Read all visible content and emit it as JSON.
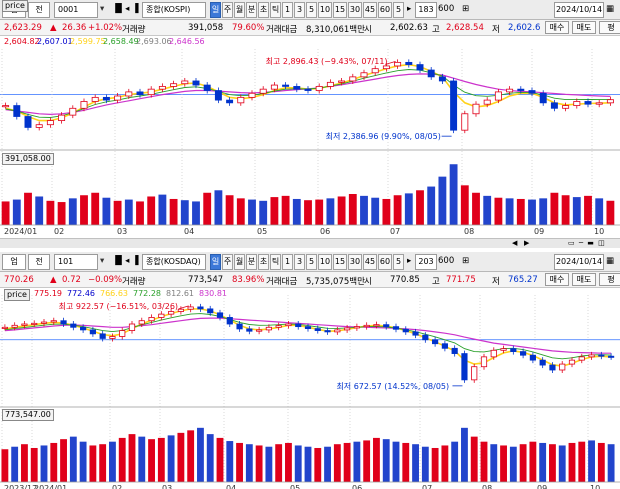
{
  "panels": [
    {
      "toolbar": {
        "type": "업",
        "mode": "전",
        "code": "0001",
        "index_name": "종합(KOSPI)",
        "period_buttons": [
          "일",
          "주",
          "월",
          "분",
          "초",
          "틱",
          "1",
          "3",
          "5",
          "10",
          "15",
          "30",
          "45",
          "60",
          "5"
        ],
        "selected_period": "일",
        "count": "183",
        "total": "600",
        "date": "2024/10/14",
        "volume_label": "거래량",
        "amount_label": "거래대금",
        "low_label": "저",
        "sell_button": "매수",
        "buy_button": "매도",
        "extra_button": "평"
      },
      "status": {
        "price": "2,623.29",
        "change": "26.36",
        "pct": "+1.02%",
        "volume": "391,058",
        "vol_pct": "79.60%",
        "amount": "8,310,061백만",
        "amount_unit": "시",
        "open": "2,602.63",
        "high_label": "고",
        "high": "2,628.54",
        "low": "2,602.6"
      },
      "legend": {
        "prefix": "",
        "values": [
          "2,604.82",
          "2,607.01",
          "2,599.75",
          "2,658.49",
          "2,693.06",
          "2,646.56"
        ],
        "colors": [
          "#e0001a",
          "#0000cc",
          "#ffd21a",
          "#2aa02a",
          "#808080",
          "#cc33cc"
        ],
        "price_tag": "price",
        "volume_tag": "391,058.00"
      },
      "annotations": {
        "high": "최고 2,896.43 (−9.43%, 07/11)",
        "low": "최저 2,386.96 (9.90%, 08/05)"
      },
      "chart_data": {
        "type": "line",
        "title": "종합(KOSPI)",
        "x_ticks": [
          "2024/01",
          "02",
          "03",
          "04",
          "05",
          "06",
          "07",
          "08",
          "09",
          "10"
        ],
        "price_series": [
          2580,
          2500,
          2420,
          2440,
          2470,
          2510,
          2560,
          2610,
          2640,
          2620,
          2650,
          2680,
          2660,
          2700,
          2720,
          2740,
          2760,
          2730,
          2690,
          2620,
          2600,
          2640,
          2670,
          2700,
          2730,
          2720,
          2700,
          2690,
          2720,
          2750,
          2760,
          2790,
          2820,
          2850,
          2870,
          2896,
          2880,
          2840,
          2790,
          2760,
          2400,
          2520,
          2590,
          2620,
          2680,
          2700,
          2690,
          2670,
          2600,
          2560,
          2580,
          2610,
          2590,
          2600,
          2623
        ],
        "ma_slow": [
          2550,
          2540,
          2530,
          2520,
          2515,
          2520,
          2530,
          2545,
          2565,
          2585,
          2600,
          2615,
          2630,
          2645,
          2660,
          2672,
          2684,
          2690,
          2690,
          2686,
          2680,
          2675,
          2672,
          2676,
          2682,
          2690,
          2696,
          2702,
          2710,
          2720,
          2732,
          2746,
          2760,
          2774,
          2788,
          2800,
          2808,
          2812,
          2810,
          2804,
          2780,
          2756,
          2734,
          2716,
          2700,
          2690,
          2684,
          2680,
          2674,
          2668,
          2662,
          2658,
          2654,
          2650,
          2647
        ],
        "ma_fast": [
          2560,
          2540,
          2500,
          2470,
          2470,
          2490,
          2525,
          2570,
          2610,
          2630,
          2640,
          2660,
          2670,
          2680,
          2700,
          2720,
          2740,
          2745,
          2720,
          2680,
          2640,
          2630,
          2640,
          2660,
          2690,
          2710,
          2710,
          2700,
          2705,
          2725,
          2745,
          2770,
          2800,
          2825,
          2850,
          2870,
          2880,
          2865,
          2830,
          2790,
          2680,
          2600,
          2570,
          2580,
          2610,
          2650,
          2670,
          2670,
          2640,
          2600,
          2585,
          2590,
          2595,
          2597,
          2600
        ],
        "volume": [
          380,
          410,
          520,
          460,
          390,
          370,
          430,
          480,
          520,
          440,
          390,
          410,
          380,
          460,
          490,
          420,
          400,
          380,
          520,
          560,
          480,
          430,
          410,
          390,
          450,
          470,
          420,
          400,
          410,
          430,
          460,
          500,
          470,
          440,
          420,
          480,
          510,
          560,
          620,
          780,
          980,
          640,
          520,
          470,
          440,
          430,
          420,
          410,
          430,
          520,
          480,
          450,
          470,
          430,
          391
        ],
        "volume_colors": [
          "r",
          "b",
          "r",
          "b",
          "r",
          "r",
          "b",
          "r",
          "r",
          "b",
          "r",
          "b",
          "r",
          "r",
          "b",
          "r",
          "b",
          "b",
          "r",
          "b",
          "r",
          "r",
          "b",
          "b",
          "r",
          "r",
          "b",
          "r",
          "r",
          "b",
          "r",
          "r",
          "b",
          "b",
          "r",
          "r",
          "b",
          "r",
          "b",
          "b",
          "b",
          "r",
          "r",
          "b",
          "r",
          "b",
          "r",
          "b",
          "b",
          "r",
          "r",
          "b",
          "r",
          "b",
          "r"
        ],
        "ylim": [
          2350,
          2950
        ],
        "vol_max": 1000
      }
    },
    {
      "toolbar": {
        "type": "업",
        "mode": "전",
        "code": "101",
        "index_name": "종합(KOSDAQ)",
        "period_buttons": [
          "일",
          "주",
          "월",
          "분",
          "초",
          "틱",
          "1",
          "3",
          "5",
          "10",
          "15",
          "30",
          "45",
          "60",
          "5"
        ],
        "selected_period": "일",
        "count": "203",
        "total": "600",
        "date": "2024/10/14",
        "volume_label": "거래량",
        "amount_label": "거래대금",
        "low_label": "저",
        "sell_button": "매수",
        "buy_button": "매도",
        "extra_button": "평"
      },
      "status": {
        "price": "770.26",
        "change": "0.72",
        "pct": "−0.09%",
        "volume": "773,547",
        "vol_pct": "83.96%",
        "amount": "5,735,075백만",
        "amount_unit": "시",
        "open": "770.85",
        "high_label": "고",
        "high": "771.75",
        "low": "765.27"
      },
      "legend": {
        "prefix": "price",
        "values": [
          "775.19",
          "772.46",
          "766.63",
          "772.28",
          "812.61",
          "830.81"
        ],
        "colors": [
          "#e0001a",
          "#0000cc",
          "#ffd21a",
          "#2aa02a",
          "#808080",
          "#cc33cc"
        ],
        "price_tag": "price",
        "volume_tag": "773,547.00"
      },
      "annotations": {
        "high": "최고 922.57 (−16.51%, 03/26)",
        "low": "최저 672.57 (14.52%, 08/05)"
      },
      "chart_data": {
        "type": "line",
        "title": "종합(KOSDAQ)",
        "x_ticks": [
          "2023/12",
          "2024/01",
          "02",
          "03",
          "04",
          "05",
          "06",
          "07",
          "08",
          "09",
          "10"
        ],
        "price_series": [
          860,
          866,
          870,
          872,
          876,
          880,
          870,
          860,
          852,
          840,
          826,
          832,
          850,
          870,
          880,
          890,
          900,
          908,
          915,
          922,
          916,
          904,
          890,
          870,
          855,
          848,
          852,
          860,
          865,
          870,
          862,
          856,
          850,
          846,
          852,
          858,
          862,
          866,
          868,
          862,
          854,
          846,
          836,
          822,
          810,
          796,
          780,
          700,
          740,
          770,
          790,
          795,
          786,
          775,
          760,
          745,
          730,
          748,
          760,
          770,
          776,
          772,
          770
        ],
        "ma_slow": [
          850,
          852,
          855,
          858,
          861,
          864,
          866,
          867,
          866,
          864,
          862,
          860,
          860,
          862,
          865,
          868,
          872,
          876,
          880,
          884,
          887,
          888,
          888,
          886,
          884,
          882,
          880,
          878,
          876,
          874,
          872,
          870,
          868,
          866,
          864,
          862,
          861,
          860,
          859,
          858,
          857,
          855,
          853,
          850,
          846,
          842,
          837,
          830,
          824,
          818,
          812,
          808,
          804,
          800,
          796,
          792,
          788,
          786,
          784,
          783,
          782,
          781,
          781
        ],
        "ma_fast": [
          855,
          860,
          864,
          868,
          872,
          875,
          873,
          866,
          858,
          848,
          838,
          834,
          840,
          856,
          870,
          882,
          892,
          902,
          910,
          916,
          916,
          910,
          898,
          882,
          866,
          855,
          852,
          855,
          860,
          866,
          866,
          860,
          854,
          848,
          849,
          854,
          859,
          864,
          866,
          864,
          858,
          850,
          840,
          828,
          816,
          802,
          788,
          760,
          748,
          752,
          768,
          782,
          788,
          784,
          774,
          760,
          746,
          742,
          750,
          762,
          770,
          772,
          770
        ],
        "volume": [
          520,
          560,
          600,
          540,
          580,
          620,
          680,
          720,
          640,
          580,
          600,
          640,
          700,
          760,
          720,
          680,
          700,
          740,
          780,
          820,
          860,
          760,
          700,
          650,
          620,
          600,
          580,
          560,
          600,
          620,
          580,
          560,
          540,
          560,
          600,
          620,
          640,
          660,
          700,
          680,
          640,
          620,
          600,
          560,
          540,
          580,
          640,
          860,
          720,
          640,
          600,
          580,
          560,
          600,
          640,
          620,
          600,
          580,
          620,
          640,
          660,
          620,
          600
        ],
        "volume_colors": [
          "r",
          "b",
          "r",
          "r",
          "b",
          "r",
          "r",
          "b",
          "b",
          "r",
          "r",
          "b",
          "r",
          "r",
          "b",
          "r",
          "r",
          "b",
          "r",
          "r",
          "b",
          "b",
          "r",
          "b",
          "r",
          "b",
          "r",
          "b",
          "r",
          "r",
          "b",
          "b",
          "r",
          "b",
          "r",
          "r",
          "b",
          "r",
          "r",
          "b",
          "b",
          "r",
          "b",
          "b",
          "r",
          "r",
          "b",
          "b",
          "r",
          "r",
          "b",
          "r",
          "b",
          "r",
          "r",
          "b",
          "r",
          "b",
          "r",
          "r",
          "b",
          "r",
          "b"
        ],
        "ylim": [
          660,
          940
        ],
        "vol_max": 1000
      }
    }
  ]
}
